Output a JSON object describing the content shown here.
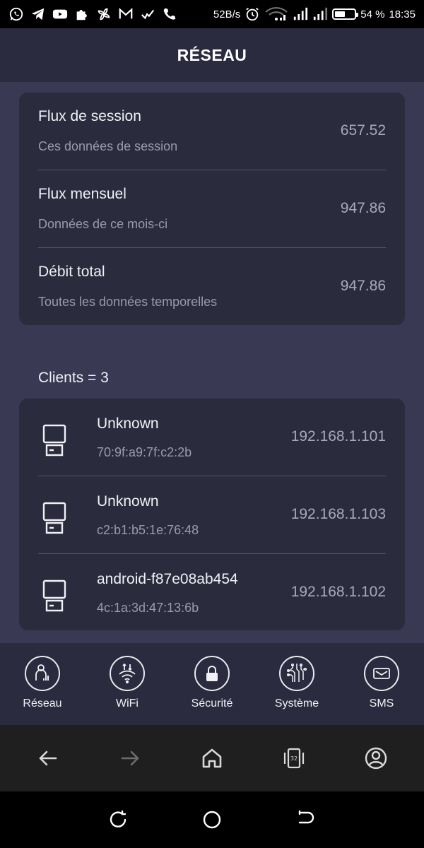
{
  "status_bar": {
    "speed": "52B/s",
    "battery": "54 %",
    "battery_level": 0.54,
    "time": "18:35",
    "icons": [
      "whatsapp-icon",
      "telegram-icon",
      "youtube-icon",
      "puzzle-icon",
      "pinwheel-icon",
      "gmail-icon",
      "check-icon",
      "phone-icon",
      "alarm-icon",
      "wifi-icon",
      "signal-icon",
      "signal-icon"
    ]
  },
  "header": {
    "title": "RÉSEAU"
  },
  "stats": [
    {
      "title": "Flux de session",
      "subtitle": "Ces données de session",
      "value": "657.52"
    },
    {
      "title": "Flux mensuel",
      "subtitle": "Données de ce mois-ci",
      "value": "947.86"
    },
    {
      "title": "Débit total",
      "subtitle": "Toutes les données temporelles",
      "value": "947.86"
    }
  ],
  "clients": {
    "heading": "Clients = 3",
    "items": [
      {
        "name": "Unknown",
        "mac": "70:9f:a9:7f:c2:2b",
        "ip": "192.168.1.101",
        "icon": "computer-icon"
      },
      {
        "name": "Unknown",
        "mac": "c2:b1:b5:1e:76:48",
        "ip": "192.168.1.103",
        "icon": "computer-icon"
      },
      {
        "name": "android-f87e08ab454",
        "mac": "4c:1a:3d:47:13:6b",
        "ip": "192.168.1.102",
        "icon": "computer-icon"
      }
    ]
  },
  "tabs": [
    {
      "label": "Réseau",
      "icon": "network-user-icon"
    },
    {
      "label": "WiFi",
      "icon": "wifi-transfer-icon"
    },
    {
      "label": "Sécurité",
      "icon": "lock-icon"
    },
    {
      "label": "Système",
      "icon": "circuit-icon"
    },
    {
      "label": "SMS",
      "icon": "envelope-icon"
    }
  ],
  "browser_bar": {
    "tab_count": "32",
    "icons": [
      "back-arrow-icon",
      "forward-arrow-icon",
      "home-icon",
      "tabs-icon",
      "profile-icon"
    ]
  },
  "system_bar": {
    "icons": [
      "recent-apps-icon",
      "home-circle-icon",
      "back-icon"
    ]
  },
  "colors": {
    "background": "#393953",
    "card": "#2b2b3e",
    "header": "#2b2b40",
    "text": "#f1f1f5",
    "muted": "#9a9aab"
  }
}
